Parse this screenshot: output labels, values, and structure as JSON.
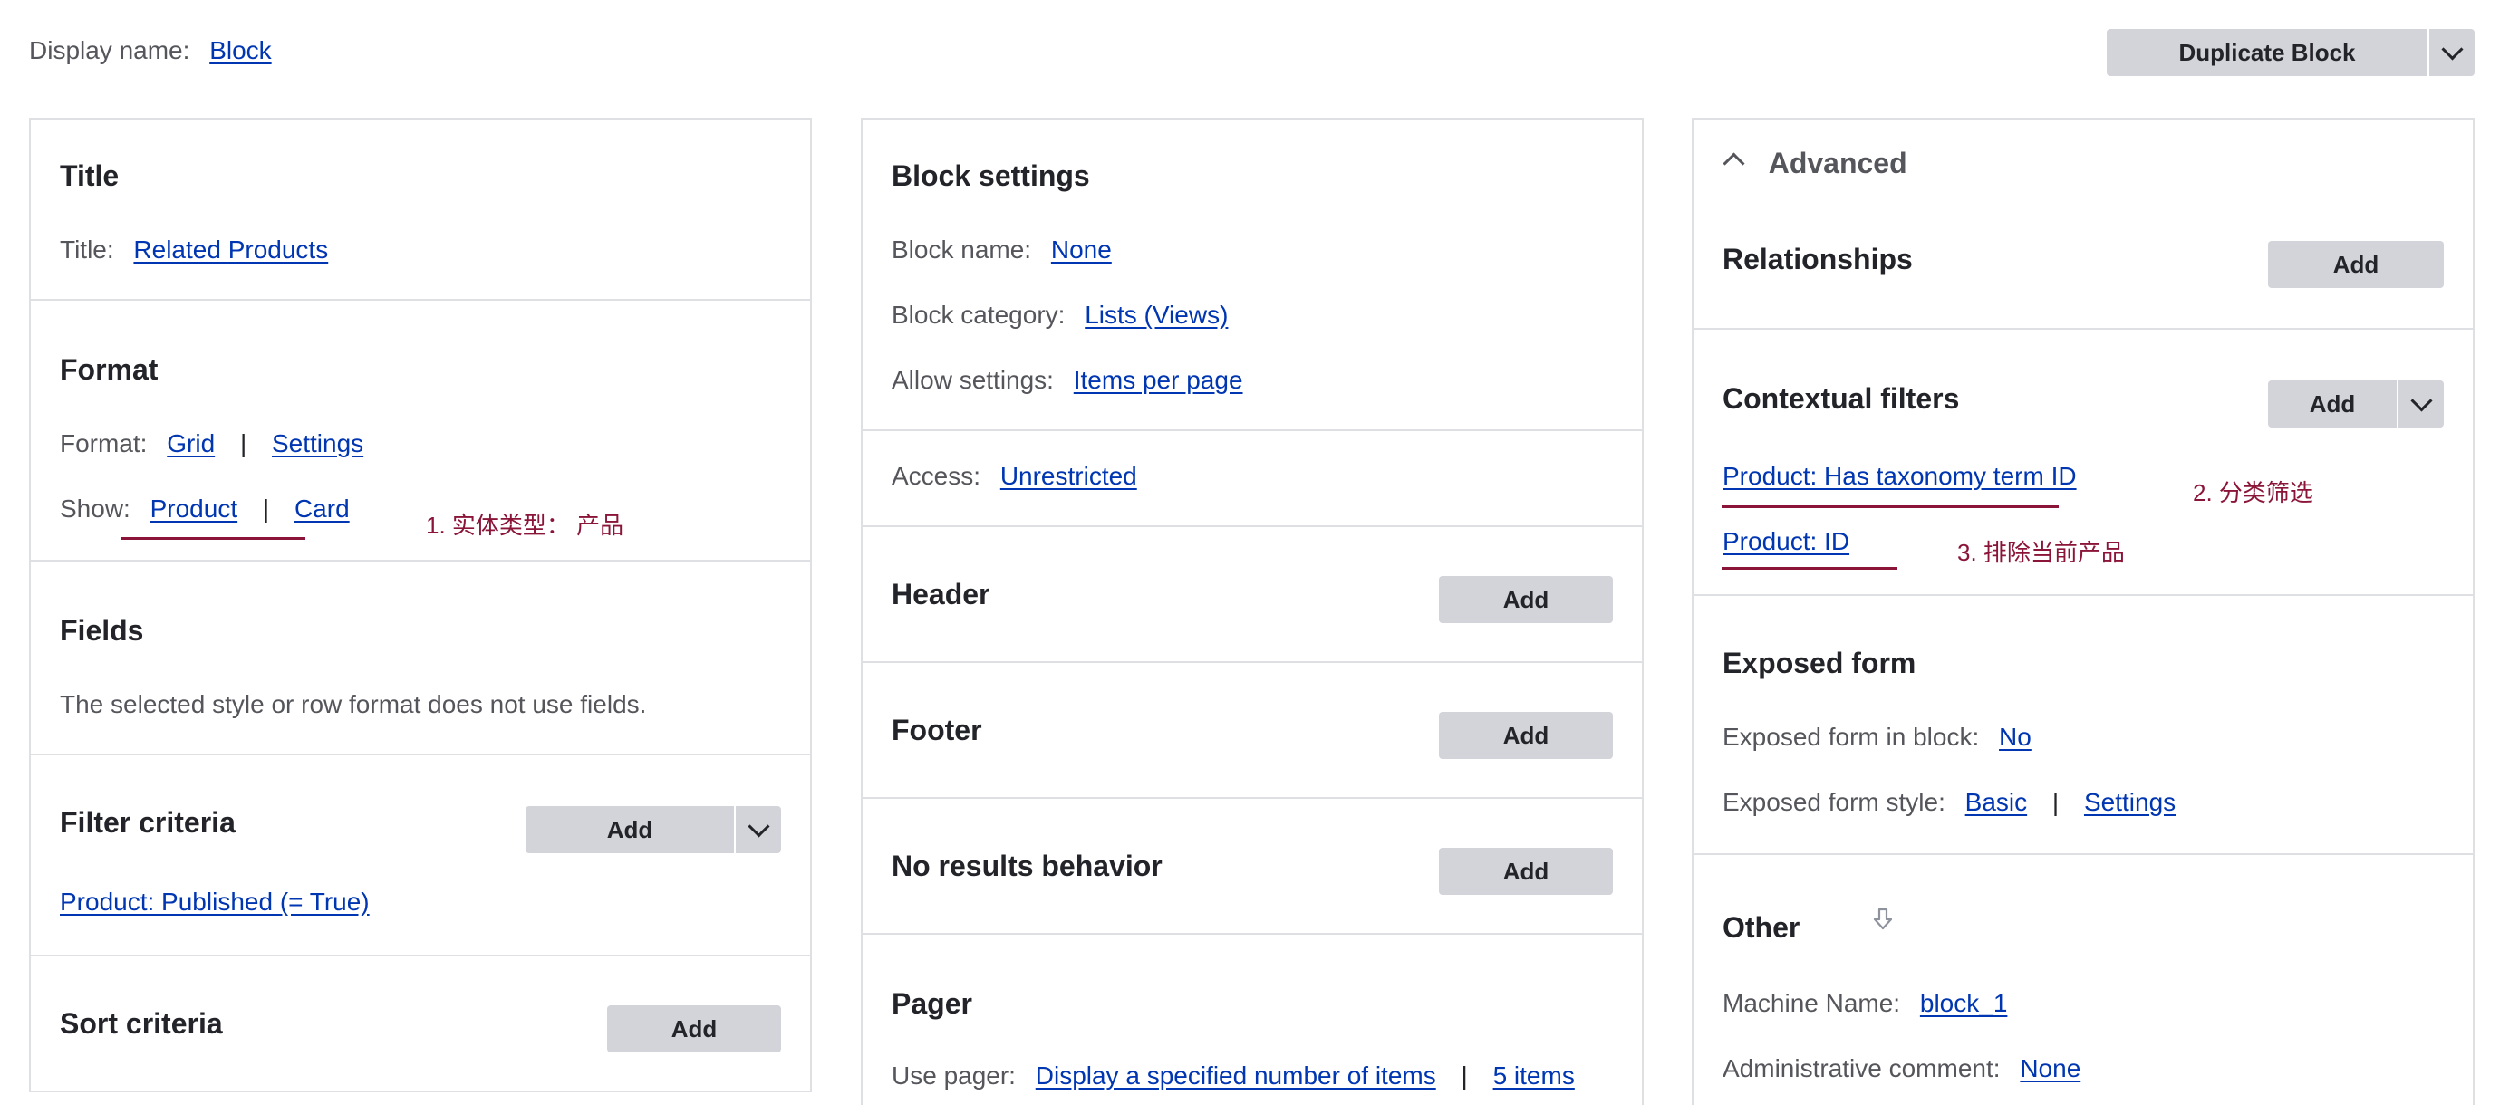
{
  "top": {
    "display_name_label": "Display name:",
    "display_name_value": "Block",
    "duplicate_button": "Duplicate Block"
  },
  "col1": {
    "title": {
      "heading": "Title",
      "label": "Title:",
      "value": "Related Products"
    },
    "format": {
      "heading": "Format",
      "format_label": "Format:",
      "format_value": "Grid",
      "settings": "Settings",
      "show_label": "Show:",
      "show_value": "Product",
      "show_mode": "Card"
    },
    "fields": {
      "heading": "Fields",
      "text": "The selected style or row format does not use fields."
    },
    "filter_criteria": {
      "heading": "Filter criteria",
      "add": "Add",
      "item": "Product: Published (= True)"
    },
    "sort_criteria": {
      "heading": "Sort criteria",
      "add": "Add"
    }
  },
  "col2": {
    "block_settings": {
      "heading": "Block settings",
      "name_label": "Block name:",
      "name_value": "None",
      "category_label": "Block category:",
      "category_value": "Lists (Views)",
      "allow_label": "Allow settings:",
      "allow_value": "Items per page"
    },
    "access": {
      "label": "Access:",
      "value": "Unrestricted"
    },
    "header": {
      "heading": "Header",
      "add": "Add"
    },
    "footer": {
      "heading": "Footer",
      "add": "Add"
    },
    "no_results": {
      "heading": "No results behavior",
      "add": "Add"
    },
    "pager": {
      "heading": "Pager",
      "label": "Use pager:",
      "value": "Display a specified number of items",
      "items": "5 items"
    }
  },
  "col3": {
    "advanced_toggle": "Advanced",
    "relationships": {
      "heading": "Relationships",
      "add": "Add"
    },
    "contextual_filters": {
      "heading": "Contextual filters",
      "add": "Add",
      "items": [
        "Product: Has taxonomy term ID",
        "Product: ID"
      ]
    },
    "exposed_form": {
      "heading": "Exposed form",
      "in_block_label": "Exposed form in block:",
      "in_block_value": "No",
      "style_label": "Exposed form style:",
      "style_value": "Basic",
      "settings": "Settings"
    },
    "other": {
      "heading": "Other",
      "machine_label": "Machine Name:",
      "machine_value": "block_1",
      "comment_label": "Administrative comment:",
      "comment_value": "None"
    }
  },
  "annotations": {
    "note1": "1. 实体类型： 产品",
    "note2": "2. 分类筛选",
    "note3": "3. 排除当前产品"
  },
  "colors": {
    "link": "#0036b1",
    "annotation": "#8a1538",
    "button": "#d3d4d9",
    "border": "#dfe0e4"
  }
}
